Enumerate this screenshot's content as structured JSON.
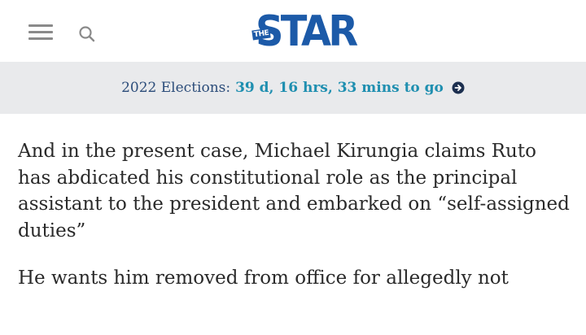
{
  "header": {
    "menu_icon": "hamburger-menu-icon",
    "search_icon": "search-icon",
    "logo": {
      "small": "THE",
      "word": "STAR"
    }
  },
  "banner": {
    "label": "2022 Elections:",
    "countdown": "39 d, 16 hrs, 33 mins to go",
    "arrow_icon": "circle-arrow-right-icon"
  },
  "article": {
    "paragraphs": [
      "And in the present case, Michael Kirungia claims Ruto has abdicated his constitutional role as the principal assistant to the president and embarked on “self-assigned duties”",
      "He wants him removed from office for allegedly not"
    ]
  },
  "colors": {
    "brand": "#1c5aa8",
    "banner_bg": "#e9eaec",
    "countdown": "#1f8fb0",
    "label": "#2c4d7a"
  }
}
